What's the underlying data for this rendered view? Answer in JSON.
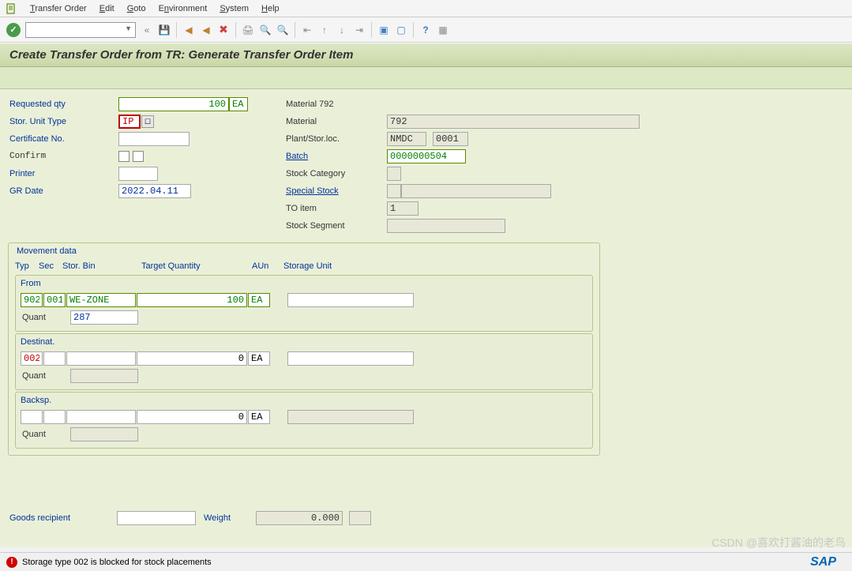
{
  "menubar": {
    "items": [
      "Transfer Order",
      "Edit",
      "Goto",
      "Environment",
      "System",
      "Help"
    ],
    "keys": [
      "T",
      "E",
      "G",
      "n",
      "S",
      "H"
    ]
  },
  "title": "Create Transfer Order from TR: Generate Transfer Order Item",
  "left": {
    "reqQtyLbl": "Requested qty",
    "reqQty": "100",
    "reqQtyUom": "EA",
    "sutLbl": "Stor. Unit Type",
    "sut": "IP",
    "certLbl": "Certificate No.",
    "cert": "",
    "confirmLbl": "Confirm",
    "printerLbl": "Printer",
    "printer": "",
    "grDateLbl": "GR Date",
    "grDate": "2022.04.11"
  },
  "right": {
    "matHeader": "Material 792",
    "matLbl": "Material",
    "mat": "792",
    "plantLbl": "Plant/Stor.loc.",
    "plant": "NMDC",
    "sloc": "0001",
    "batchLbl": "Batch",
    "batch": "0000000504",
    "stockCatLbl": "Stock Category",
    "stockCat": "",
    "specStockLbl": "Special Stock",
    "specStock1": "",
    "specStock2": "",
    "toItemLbl": "TO item",
    "toItem": "1",
    "stockSegLbl": "Stock Segment",
    "stockSeg": ""
  },
  "movement": {
    "title": "Movement data",
    "hdr": {
      "typ": "Typ",
      "sec": "Sec",
      "bin": "Stor. Bin",
      "tq": "Target Quantity",
      "aun": "AUn",
      "su": "Storage Unit"
    },
    "from": {
      "title": "From",
      "typ": "902",
      "sec": "001",
      "bin": "WE-ZONE",
      "qty": "100",
      "uom": "EA",
      "su": "",
      "quantLbl": "Quant",
      "quant": "287"
    },
    "dest": {
      "title": "Destinat.",
      "typ": "002",
      "sec": "",
      "bin": "",
      "qty": "0",
      "uom": "EA",
      "su": "",
      "quantLbl": "Quant",
      "quant": ""
    },
    "back": {
      "title": "Backsp.",
      "typ": "",
      "sec": "",
      "bin": "",
      "qty": "0",
      "uom": "EA",
      "su": "",
      "quantLbl": "Quant",
      "quant": ""
    }
  },
  "footer": {
    "goodsRecLbl": "Goods recipient",
    "goodsRec": "",
    "weightLbl": "Weight",
    "weight": "0.000",
    "weightUom": ""
  },
  "status": "Storage type 002 is blocked for stock placements",
  "watermark": "CSDN @喜欢打酱油的老鸟",
  "sap": "SAP"
}
